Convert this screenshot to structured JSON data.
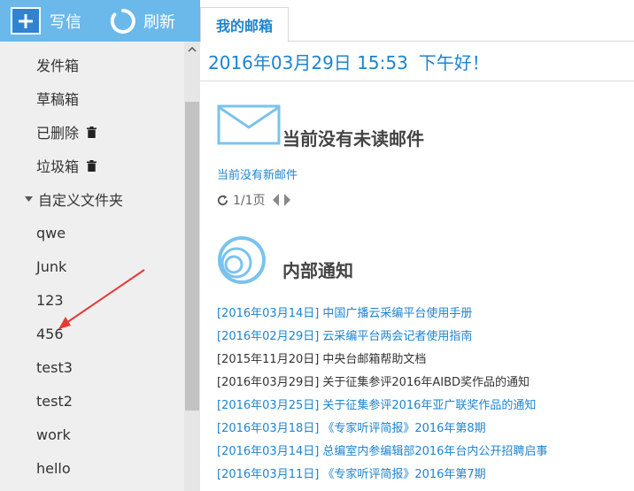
{
  "toolbar": {
    "compose_label": "写信",
    "refresh_label": "刷新"
  },
  "folders": [
    {
      "label": "发件箱",
      "trash": false,
      "custom_header": false
    },
    {
      "label": "草稿箱",
      "trash": false,
      "custom_header": false
    },
    {
      "label": "已删除",
      "trash": true,
      "custom_header": false
    },
    {
      "label": "垃圾箱",
      "trash": true,
      "custom_header": false
    },
    {
      "label": "自定义文件夹",
      "trash": false,
      "custom_header": true
    },
    {
      "label": "qwe",
      "trash": false,
      "custom_header": false
    },
    {
      "label": "Junk",
      "trash": false,
      "custom_header": false
    },
    {
      "label": "123",
      "trash": false,
      "custom_header": false
    },
    {
      "label": "456",
      "trash": false,
      "custom_header": false
    },
    {
      "label": "test3",
      "trash": false,
      "custom_header": false
    },
    {
      "label": "test2",
      "trash": false,
      "custom_header": false
    },
    {
      "label": "work",
      "trash": false,
      "custom_header": false
    },
    {
      "label": "hello",
      "trash": false,
      "custom_header": false
    }
  ],
  "tab": {
    "label": "我的邮箱"
  },
  "greeting": {
    "datetime": "2016年03月29日 15:53",
    "text": "下午好！"
  },
  "unread": {
    "title": "当前没有未读邮件",
    "no_new": "当前没有新邮件",
    "page": "1/1页"
  },
  "notices": {
    "title": "内部通知",
    "items": [
      {
        "date": "[2016年03月14日]",
        "text": "中国广播云采编平台使用手册",
        "read": false
      },
      {
        "date": "[2016年02月29日]",
        "text": "云采编平台两会记者使用指南",
        "read": false
      },
      {
        "date": "[2015年11月20日]",
        "text": "中央台邮箱帮助文档",
        "read": true
      },
      {
        "date": "[2016年03月29日]",
        "text": "关于征集参评2016年AIBD奖作品的通知",
        "read": true
      },
      {
        "date": "[2016年03月25日]",
        "text": "关于征集参评2016年亚广联奖作品的通知",
        "read": false
      },
      {
        "date": "[2016年03月18日]",
        "text": "《专家听评简报》2016年第8期",
        "read": false
      },
      {
        "date": "[2016年03月14日]",
        "text": "总编室内参编辑部2016年台内公开招聘启事",
        "read": false
      },
      {
        "date": "[2016年03月11日]",
        "text": "《专家听评简报》2016年第7期",
        "read": false
      }
    ]
  },
  "colors": {
    "accent": "#1d84d0",
    "topbar": "#6bb8eb",
    "annotation": "#e53935"
  }
}
